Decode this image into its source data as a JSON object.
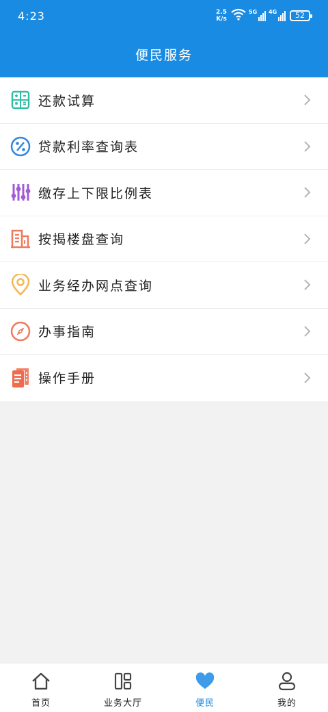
{
  "status_bar": {
    "time": "4:23",
    "net_speed_value": "2.5",
    "net_speed_unit": "K/s",
    "signal_1_label": "5G",
    "signal_2_label": "4G",
    "battery": "52"
  },
  "header": {
    "title": "便民服务"
  },
  "menu": {
    "items": [
      {
        "label": "还款试算",
        "icon": "calculator-icon",
        "color": "#2fbfa7"
      },
      {
        "label": "贷款利率查询表",
        "icon": "percent-icon",
        "color": "#2f86e0"
      },
      {
        "label": "缴存上下限比例表",
        "icon": "sliders-icon",
        "color": "#a25ad6"
      },
      {
        "label": "按揭楼盘查询",
        "icon": "building-icon",
        "color": "#f07a5e"
      },
      {
        "label": "业务经办网点查询",
        "icon": "location-pin-icon",
        "color": "#f6b757"
      },
      {
        "label": "办事指南",
        "icon": "compass-icon",
        "color": "#f07a5e"
      },
      {
        "label": "操作手册",
        "icon": "document-icon",
        "color": "#f06a4e"
      }
    ]
  },
  "tabbar": {
    "items": [
      {
        "label": "首页",
        "icon": "home-icon",
        "active": false
      },
      {
        "label": "业务大厅",
        "icon": "grid-icon",
        "active": false
      },
      {
        "label": "便民",
        "icon": "heart-icon",
        "active": true
      },
      {
        "label": "我的",
        "icon": "user-icon",
        "active": false
      }
    ]
  },
  "colors": {
    "primary": "#1a8be3",
    "background": "#f2f2f2"
  }
}
